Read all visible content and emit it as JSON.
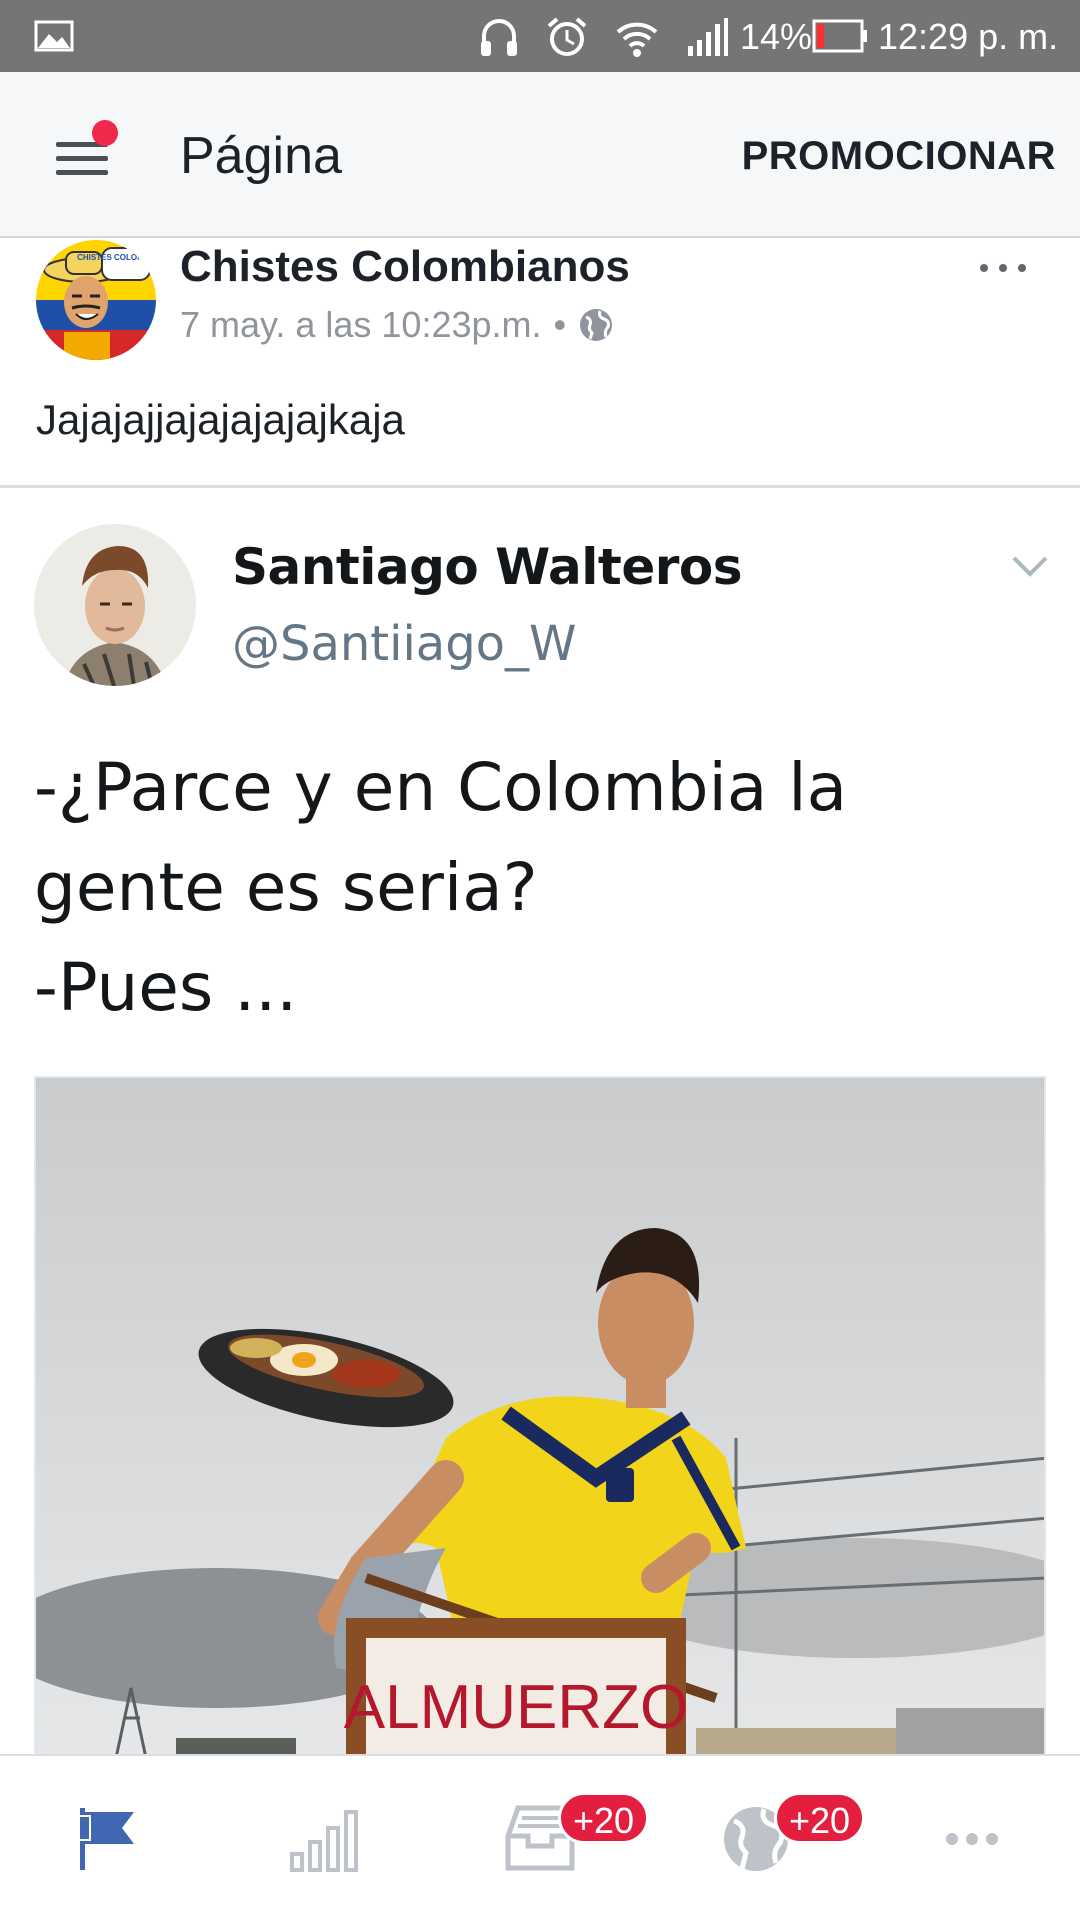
{
  "status_bar": {
    "battery": "14%",
    "time": "12:29 p. m."
  },
  "app_bar": {
    "title": "Página",
    "promote_label": "PROMOCIONAR"
  },
  "post": {
    "page_name": "Chistes Colombianos",
    "timestamp": "7 may. a las 10:23p.m.",
    "separator": "•",
    "text": "Jajajajjajajajajajkaja",
    "avatar_badge_text": "CHISTES COLOMBIANOS"
  },
  "tweet": {
    "name": "Santiago Walteros",
    "handle": "@Santiiago_W",
    "lines": [
      "-¿Parce y en Colombia la",
      "gente es seria?",
      "-Pues ..."
    ],
    "sign_text": "ALMUERZO"
  },
  "bottom_nav": {
    "items": [
      {
        "name": "page",
        "icon": "flag-icon",
        "active": true
      },
      {
        "name": "insights",
        "icon": "bar-chart-icon"
      },
      {
        "name": "inbox",
        "icon": "inbox-icon",
        "badge": "+20"
      },
      {
        "name": "notifications",
        "icon": "globe-icon",
        "badge": "+20"
      },
      {
        "name": "more",
        "icon": "more-icon"
      }
    ]
  },
  "colors": {
    "status_bar": "#757575",
    "app_bar": "#f6f7f9",
    "active": "#4267b2",
    "badge": "#e41e3f",
    "inactive_icon": "#bec2c9"
  }
}
